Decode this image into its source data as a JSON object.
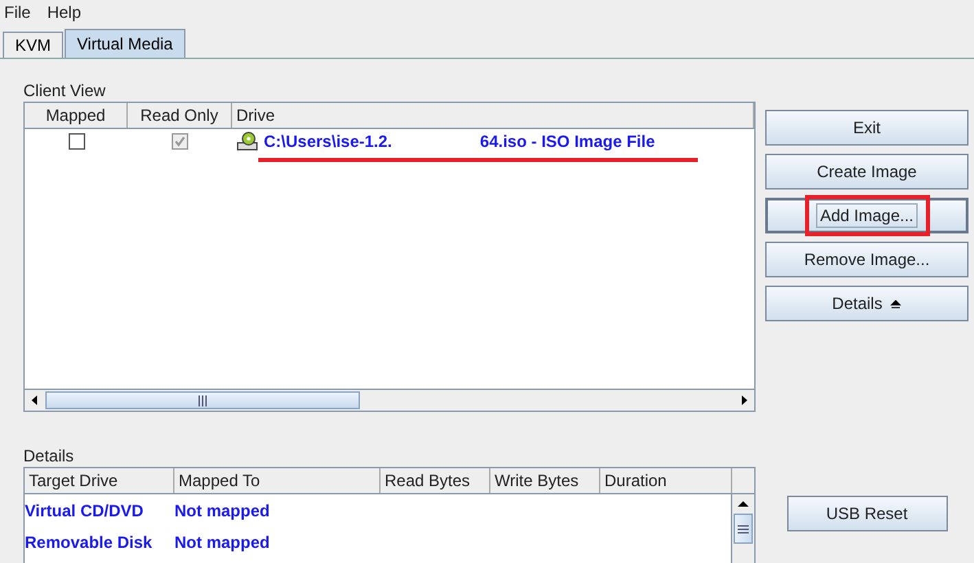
{
  "menu": [
    "File",
    "Help"
  ],
  "tabs": [
    {
      "label": "KVM",
      "selected": false
    },
    {
      "label": "Virtual Media",
      "selected": true
    }
  ],
  "client_view": {
    "title": "Client View",
    "columns": [
      "Mapped",
      "Read Only",
      "Drive"
    ],
    "rows": [
      {
        "mapped": false,
        "read_only": true,
        "read_only_disabled": true,
        "drive": [
          "C:\\Users\\ise-1.2.",
          "64.iso - ISO Image File"
        ],
        "underlined": true
      }
    ]
  },
  "buttons": [
    {
      "label": "Exit",
      "focused": false,
      "highlighted": false,
      "arrow": false
    },
    {
      "label": "Create Image",
      "focused": false,
      "highlighted": false,
      "arrow": false
    },
    {
      "label": "Add Image...",
      "focused": true,
      "highlighted": true,
      "arrow": false
    },
    {
      "label": "Remove Image...",
      "focused": false,
      "highlighted": false,
      "arrow": false
    },
    {
      "label": "Details",
      "focused": false,
      "highlighted": false,
      "arrow": true
    }
  ],
  "details": {
    "title": "Details",
    "columns": [
      "Target Drive",
      "Mapped To",
      "Read Bytes",
      "Write Bytes",
      "Duration"
    ],
    "rows": [
      [
        "Virtual CD/DVD",
        "Not mapped"
      ],
      [
        "Removable Disk",
        "Not mapped"
      ]
    ]
  },
  "usb_reset": "USB Reset"
}
